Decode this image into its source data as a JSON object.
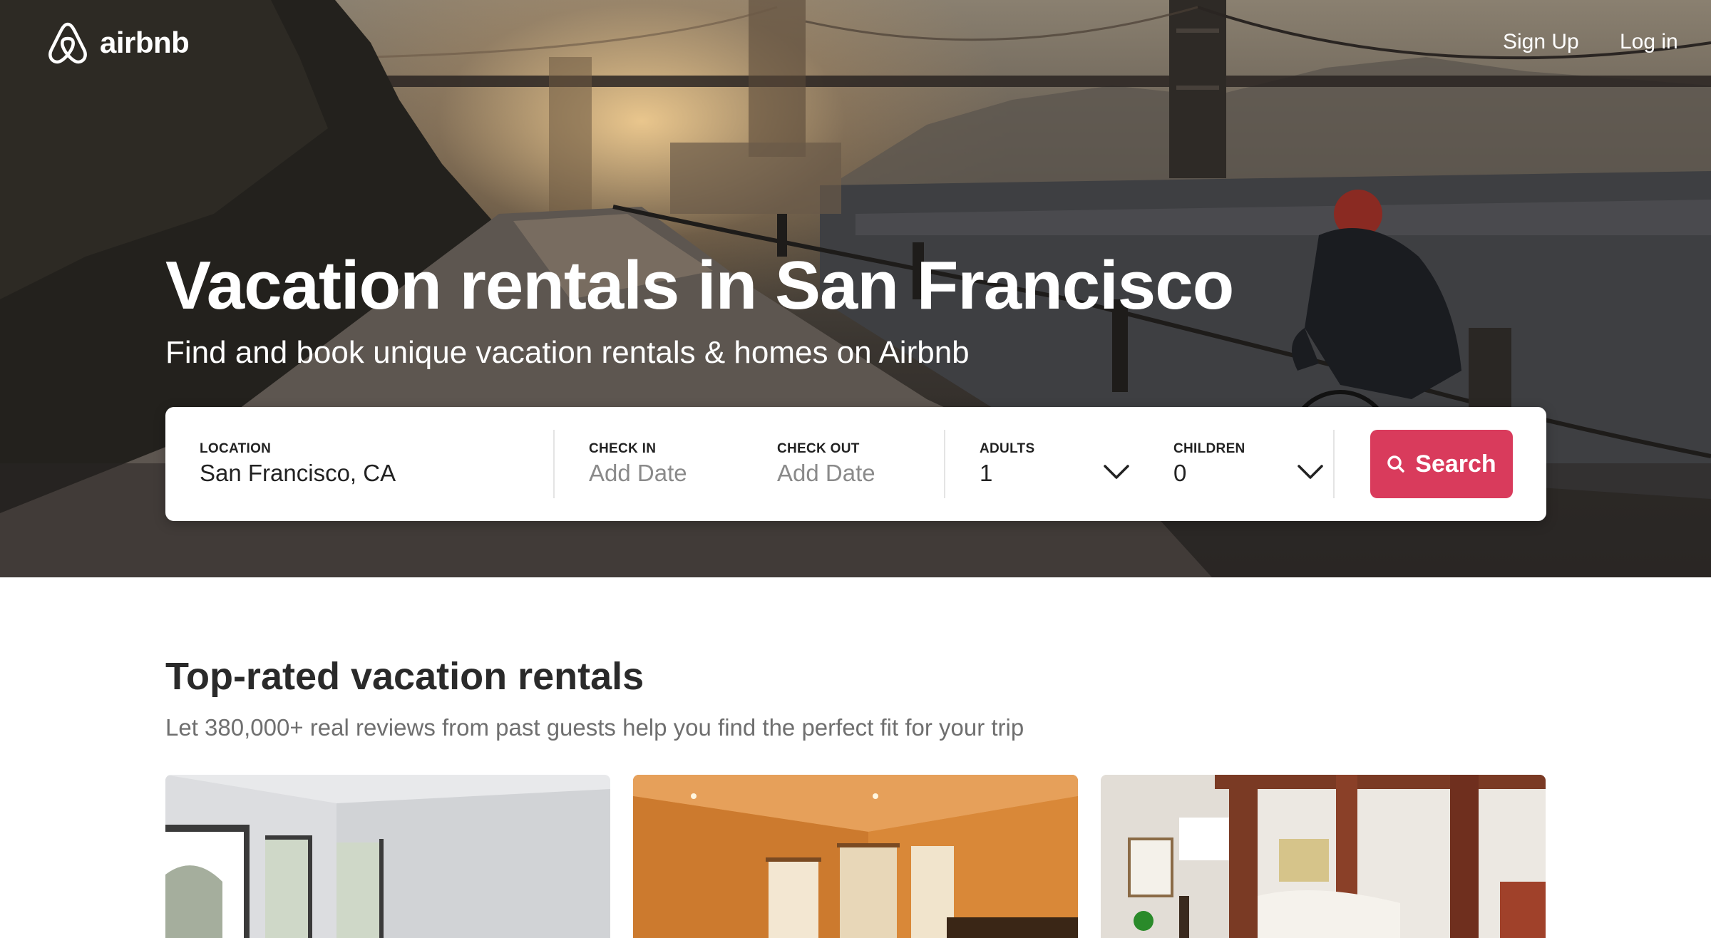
{
  "nav": {
    "brand": "airbnb",
    "signup_label": "Sign Up",
    "login_label": "Log in"
  },
  "hero": {
    "title": "Vacation rentals in San Francisco",
    "subtitle": "Find and book unique vacation rentals & homes on Airbnb"
  },
  "search": {
    "location_label": "LOCATION",
    "location_value": "San Francisco, CA",
    "checkin_label": "CHECK IN",
    "checkin_placeholder": "Add Date",
    "checkout_label": "CHECK OUT",
    "checkout_placeholder": "Add Date",
    "adults_label": "ADULTS",
    "adults_value": "1",
    "children_label": "CHILDREN",
    "children_value": "0",
    "button_label": "Search"
  },
  "section": {
    "title": "Top-rated vacation rentals",
    "subtitle": "Let 380,000+ real reviews from past guests help you find the perfect fit for your trip"
  },
  "colors": {
    "brand_accent": "#d93b5c",
    "text_primary": "#222222",
    "text_secondary": "#6f6f6f"
  },
  "icons": [
    "airbnb-logo-icon",
    "search-icon",
    "chevron-down-icon"
  ]
}
